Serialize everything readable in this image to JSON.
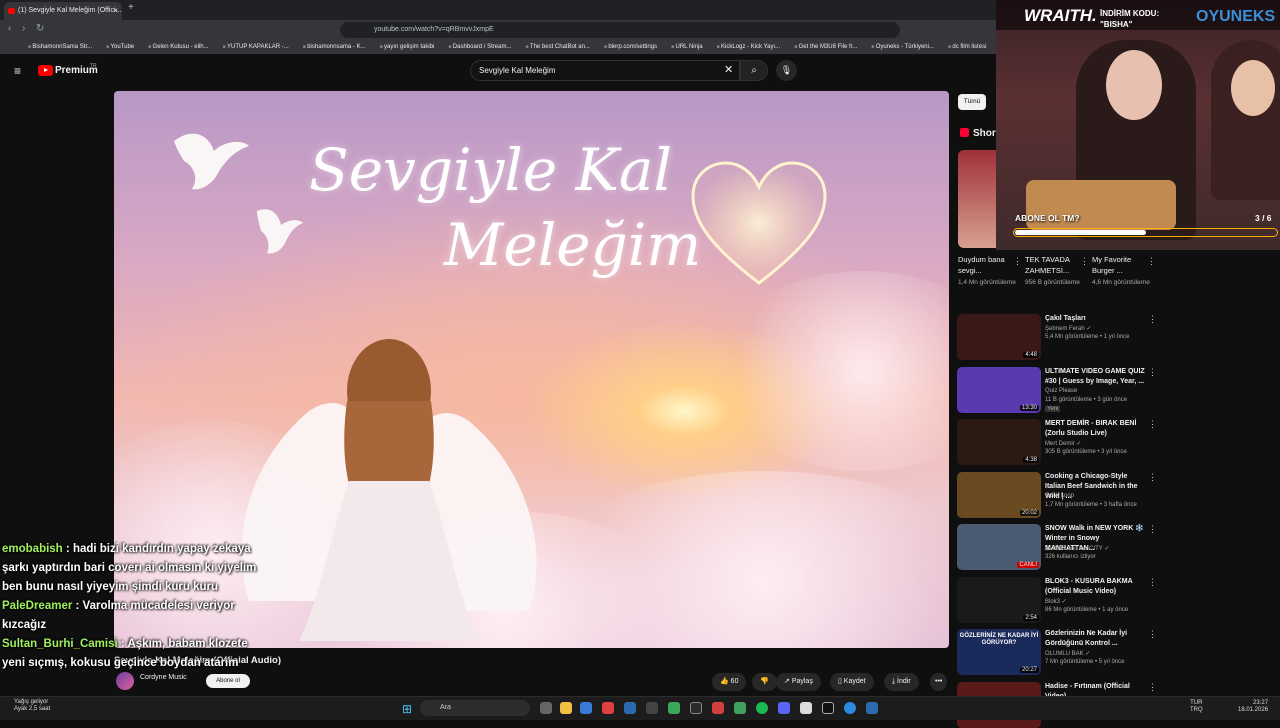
{
  "browser": {
    "tab_title": "(1) Sevgiyle Kal Meleğim (Offici...",
    "tab_close": "×",
    "new_tab": "+",
    "url": "youtube.com/watch?v=qRBmvvJxmpE",
    "bookmarks": [
      "BishamonnSama Str...",
      "YouTube",
      "Gelen Kutusu - eilh...",
      "YUTUP KAPAKLAR -...",
      "bishamonnsama - K...",
      "yayın gelişim takibi",
      "Dashboard / Stream...",
      "The best ChatBot an...",
      "blerp.com/settings",
      "URL Ninja",
      "KickLogz - Kick Yayı...",
      "Get the M3U8 File fr...",
      "Oyuneks - Türkiyeni...",
      "dc film listesi"
    ]
  },
  "youtube": {
    "brand": "Premium",
    "region": "TR",
    "search_value": "Sevgiyle Kal Meleğim",
    "clear_glyph": "✕",
    "search_glyph": "⌕",
    "mic_glyph": "🎙"
  },
  "video": {
    "title_line1": "Sevgiyle Kal",
    "title_line2": "Meleğim"
  },
  "watch": {
    "title": "Sevgiyle Kal Meleğim (Official Audio)",
    "channel": "Cordyne Music",
    "subscribe": "Abone ol",
    "likes": "60",
    "share": "Paylaş",
    "save": "Kaydet",
    "download": "İndir",
    "more": "•••"
  },
  "chat": [
    {
      "user": "emobabish",
      "text": ": hadi bizi kandırdın yapay zekaya şarkı yaptırdın bari coverı ai olmasın ki yiyelim ben bunu nasıl yiyeyim şimdi kuru kuru",
      "color": "#a0f060"
    },
    {
      "user": "PaleDreamer",
      "text": ": Varolma mücadelesi veriyor kızcağız",
      "color": "#a0f060"
    },
    {
      "user": "Sultan_Burhi_Camisi",
      "text": ": Aşkım, babam klozete yeni sıçmış, kokusu geçince boydan atarım",
      "color": "#a0f060"
    }
  ],
  "sidebar": {
    "chip_all": "Tümü",
    "shorts_label": "Shor",
    "shorts": [
      {
        "title": "Duydum bana sevgi...",
        "views": "1,4 Mn görüntüleme"
      },
      {
        "title": "TEK TAVADA ZAHMETSİ...",
        "views": "956 B görüntüleme"
      },
      {
        "title": "My Favorite Burger ...",
        "views": "4,6 Mn görüntüleme"
      }
    ],
    "recommendations": [
      {
        "title": "Çakıl Taşları",
        "channel": "Şebnem Ferah ✓",
        "meta": "5,4 Mn görüntüleme • 1 yıl önce",
        "duration": "4:48",
        "color": "#3a1818"
      },
      {
        "title": "ULTIMATE VIDEO GAME QUIZ #30 | Guess by Image, Year, ...",
        "channel": "Quiz Please",
        "meta": "11 B görüntüleme • 3 gün önce",
        "badge": "Yeni",
        "duration": "13:30",
        "color": "#5a3ab0"
      },
      {
        "title": "MERT DEMİR - BIRAK BENİ (Zorlu Studio Live)",
        "channel": "Mert Demir ✓",
        "meta": "305 B görüntüleme • 3 yıl önce",
        "duration": "4:38",
        "color": "#2a1a12"
      },
      {
        "title": "Cooking a Chicago-Style Italian Beef Sandwich in the Wild | ...",
        "channel": "Cook Loop",
        "meta": "1,7 Mn görüntüleme • 3 hafta önce",
        "duration": "20:02",
        "color": "#6a4a20"
      },
      {
        "title": "SNOW Walk in NEW YORK ❄️ Winter in Snowy MANHATTAN...",
        "channel": "WALKS and the CITY ✓",
        "meta": "326 kullanıcı izliyor",
        "duration": "CANLI",
        "color": "#4a5a70"
      },
      {
        "title": "BLOK3 - KUSURA BAKMA (Official Music Video)",
        "channel": "Blok3 ✓",
        "meta": "86 Mn görüntüleme • 1 ay önce",
        "duration": "2:54",
        "color": "#1a1a1a"
      },
      {
        "title": "Gözlerinizin Ne Kadar İyi Gördüğünü Kontrol ...",
        "channel": "OLUMLU BAK ✓",
        "meta": "7 Mn görüntüleme • 5 yıl önce",
        "duration": "20:27",
        "color": "#1a2a5a",
        "thumb_text": "GÖZLERİNİZ NE KADAR İYİ GÖRÜYOR?"
      },
      {
        "title": "Hadise - Fırtınam (Official Video)",
        "channel": "",
        "meta": "",
        "duration": "",
        "color": "#5a1a1a"
      }
    ]
  },
  "overlay": {
    "brand1": "WRAITH.",
    "discount_label": "İNDİRİM KODU:",
    "discount_code": "\"BISHA\"",
    "brand2": "OYUNEKS",
    "poll_question": "ABONE OL TM?",
    "poll_count": "3 / 6",
    "poll_fraction": 0.5
  },
  "taskbar": {
    "weather_line1": "Yağış geliyor",
    "weather_line2": "Ayak 2,5 saat",
    "search": "Ara",
    "lang1": "TUR",
    "lang2": "TRQ",
    "time": "23:27",
    "date": "18.01.2026"
  }
}
